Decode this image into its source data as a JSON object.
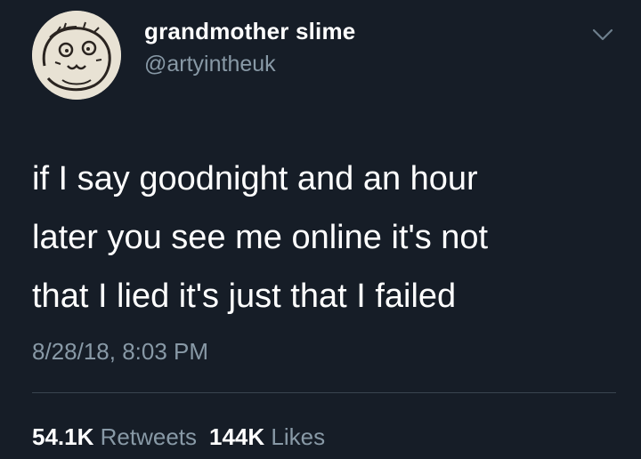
{
  "user": {
    "display_name": "grandmother slime",
    "handle": "@artyintheuk",
    "avatar_icon": "hand-drawn-face-avatar"
  },
  "tweet": {
    "lines": [
      "if I say goodnight and an hour",
      "later you see me online it's not",
      "that I lied it's just that I failed"
    ],
    "timestamp": "8/28/18, 8:03 PM"
  },
  "stats": {
    "retweets_count": "54.1K",
    "retweets_label": "Retweets",
    "likes_count": "144K",
    "likes_label": "Likes"
  },
  "icons": {
    "menu": "chevron-down-icon"
  },
  "colors": {
    "background": "#161d27",
    "primary_text": "#ffffff",
    "secondary_text": "#8899a6",
    "divider": "#3a4450"
  }
}
